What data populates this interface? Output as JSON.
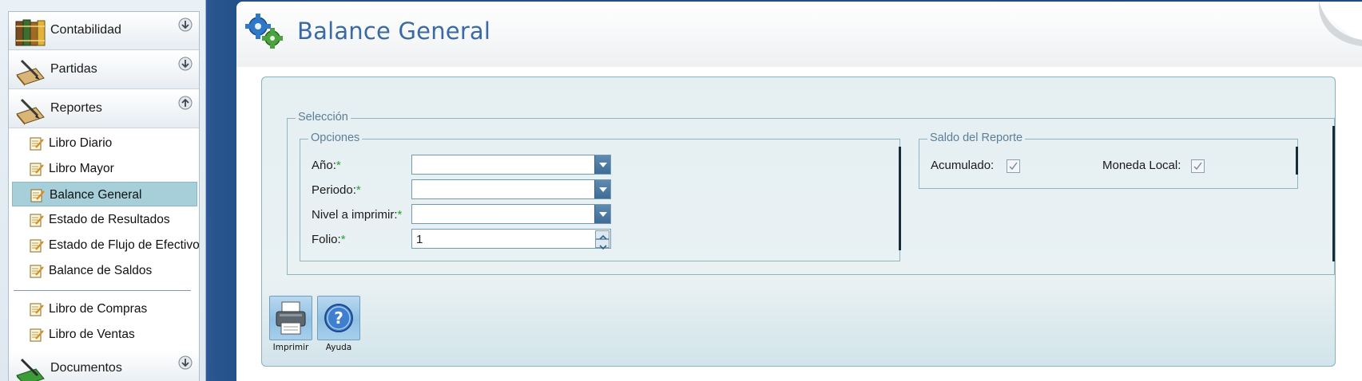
{
  "sidebar": {
    "groups": [
      {
        "label": "Contabilidad",
        "icon": "books-icon",
        "toggle": "expand"
      },
      {
        "label": "Partidas",
        "icon": "ledger-pen-icon",
        "toggle": "expand"
      },
      {
        "label": "Reportes",
        "icon": "ledger-pen-icon",
        "toggle": "collapse"
      },
      {
        "label": "Documentos",
        "icon": "green-ledger-icon",
        "toggle": "expand"
      }
    ],
    "report_items": [
      {
        "label": "Libro Diario",
        "icon": "notepad-edit-icon"
      },
      {
        "label": "Libro Mayor",
        "icon": "notepad-edit-icon"
      },
      {
        "label": "Balance General",
        "icon": "notepad-edit-icon",
        "selected": true
      },
      {
        "label": "Estado de Resultados",
        "icon": "notepad-edit-icon"
      },
      {
        "label": "Estado de Flujo de Efectivo",
        "icon": "notepad-edit-icon"
      },
      {
        "label": "Balance de Saldos",
        "icon": "notepad-edit-icon"
      },
      {
        "label": "Libro de Compras",
        "icon": "notepad-edit-icon"
      },
      {
        "label": "Libro de Ventas",
        "icon": "notepad-edit-icon"
      }
    ]
  },
  "header": {
    "title": "Balance General",
    "icon": "gears-icon"
  },
  "form": {
    "seleccion_legend": "Selección",
    "opciones_legend": "Opciones",
    "saldo_legend": "Saldo del Reporte",
    "fields": {
      "anio": {
        "label": "Año:",
        "required": "*",
        "value": ""
      },
      "periodo": {
        "label": "Periodo:",
        "required": "*",
        "value": ""
      },
      "nivel": {
        "label": "Nivel a imprimir:",
        "required": "*",
        "value": ""
      },
      "folio": {
        "label": "Folio:",
        "required": "*",
        "value": "1"
      }
    },
    "saldo": {
      "acumulado": {
        "label": "Acumulado:",
        "checked": true
      },
      "moneda_local": {
        "label": "Moneda Local:",
        "checked": true
      }
    }
  },
  "toolbar": {
    "print_label": "Imprimir",
    "help_label": "Ayuda"
  },
  "colors": {
    "accent_title": "#3a6aa3",
    "selected_item": "#a6cfd9",
    "required_mark": "#2aa033",
    "background_blue": "#2d5c9a"
  }
}
